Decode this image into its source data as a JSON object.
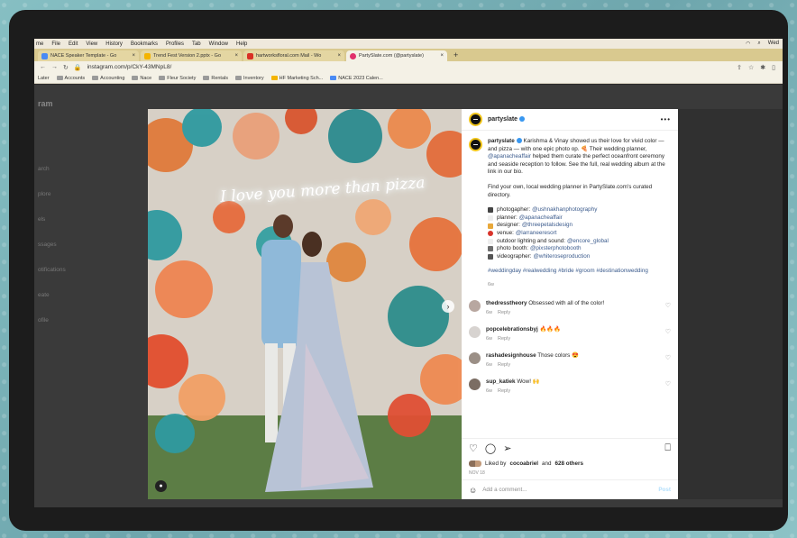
{
  "menubar": {
    "items": [
      "me",
      "File",
      "Edit",
      "View",
      "History",
      "Bookmarks",
      "Profiles",
      "Tab",
      "Window",
      "Help"
    ],
    "right": [
      "Wed"
    ]
  },
  "tabs": [
    {
      "title": "NACE Speaker Template - Go",
      "color": "#4a8af4"
    },
    {
      "title": "Trend Fest Version 2.pptx - Go",
      "color": "#f4b400"
    },
    {
      "title": "hartworksfloral.com Mail - Wo",
      "color": "#d93025"
    },
    {
      "title": "PartySlate.com (@partyslate)",
      "color": "#e1306c"
    }
  ],
  "address": {
    "url": "instagram.com/p/CkY-43MNpL8/"
  },
  "bookmarks": [
    "Later",
    "Accounts",
    "Accounting",
    "Nace",
    "Fleur Society",
    "Rentals",
    "Inventory",
    "HF Marketing Sch...",
    "NACE 2023 Calen..."
  ],
  "sidebar": {
    "logo": "ram",
    "items": [
      "",
      "arch",
      "plore",
      "els",
      "ssages",
      "otifications",
      "eate",
      "ofile"
    ]
  },
  "post": {
    "neon_text": "I love you more than pizza",
    "username": "partyslate",
    "more": "•••",
    "caption": {
      "user": "partyslate",
      "text_1": " Karishma & Vinay showed us their love for vivid color — and pizza — with one epic photo op. 🍕 Their wedding planner, ",
      "planner_link": "@apanacheaffair",
      "text_2": " helped them curate the perfect oceanfront ceremony and seaside reception to follow. See the full, real wedding album at the link in our bio.",
      "para_2": "Find your own, local wedding planner in PartySlate.com's curated directory.",
      "credits": [
        {
          "label": "photogapher: ",
          "handle": "@ushnakhanphotography",
          "color": "#444"
        },
        {
          "label": "planner: ",
          "handle": "@apanacheaffair",
          "color": "#ffffff"
        },
        {
          "label": "designer: ",
          "handle": "@threepetalsdesign",
          "color": "#e8a83a"
        },
        {
          "label": "venue: ",
          "handle": "@larraneeresort",
          "color": "#d9342b"
        },
        {
          "label": "outdoor lighting and sound: ",
          "handle": "@encore_global",
          "color": "#ffffff"
        },
        {
          "label": "photo booth: ",
          "handle": "@pixsterphotobooth",
          "color": "#6d6d6d"
        },
        {
          "label": "videographer: ",
          "handle": "@whiteroseproduction",
          "color": "#555"
        }
      ],
      "hashtags": "#weddingday #realwedding #bride #groom #destinationwedding",
      "time": "6w"
    },
    "comments": [
      {
        "user": "thedresstheory",
        "text": "Obsessed with all of the color!",
        "time": "6w",
        "reply": "Reply",
        "avatar": "#b8a7a0"
      },
      {
        "user": "popcelebrationsbyj",
        "text": "🔥🔥🔥",
        "time": "6w",
        "reply": "Reply",
        "avatar": "#d7d3d0"
      },
      {
        "user": "rashadesignhouse",
        "text": "Those colors 😍",
        "time": "6w",
        "reply": "Reply",
        "avatar": "#9b8f86"
      },
      {
        "user": "sup_katiek",
        "text": "Wow! 🙌",
        "time": "6w",
        "reply": "Reply",
        "avatar": "#7b6d63"
      }
    ],
    "likes": {
      "prefix": "Liked by ",
      "user": "cocoabriel",
      "mid": " and ",
      "count": "628 others"
    },
    "date": "NOV 18",
    "add_comment_placeholder": "Add a comment...",
    "post_label": "Post",
    "icons": {
      "like": "heart-icon",
      "comment": "comment-icon",
      "share": "share-icon",
      "save": "bookmark-icon"
    }
  }
}
